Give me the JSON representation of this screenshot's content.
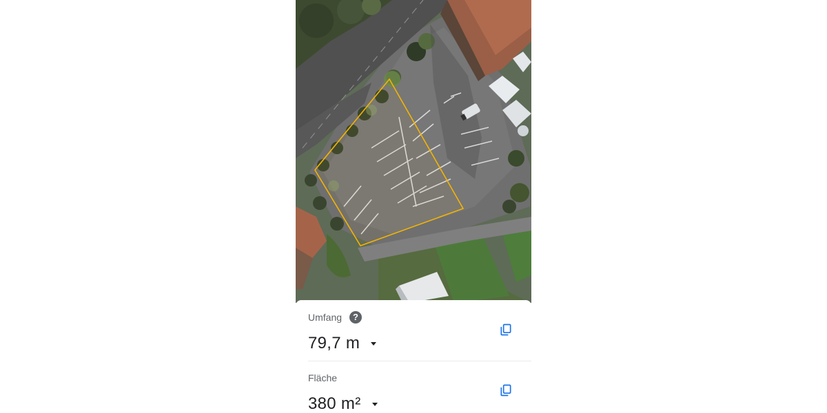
{
  "map": {
    "view": "satellite",
    "polygon_color": "#f4b400"
  },
  "perimeter": {
    "label": "Umfang",
    "value": "79,7 m",
    "help_icon": "help-icon",
    "copy_icon": "copy-icon",
    "dropdown_icon": "arrow-drop-down-icon"
  },
  "area": {
    "label": "Fläche",
    "value": "380 m²",
    "copy_icon": "copy-icon",
    "dropdown_icon": "arrow-drop-down-icon"
  },
  "colors": {
    "label_text": "#5f6368",
    "value_text": "#202124",
    "copy_icon": "#1a73e8",
    "divider": "#e8eaed"
  }
}
